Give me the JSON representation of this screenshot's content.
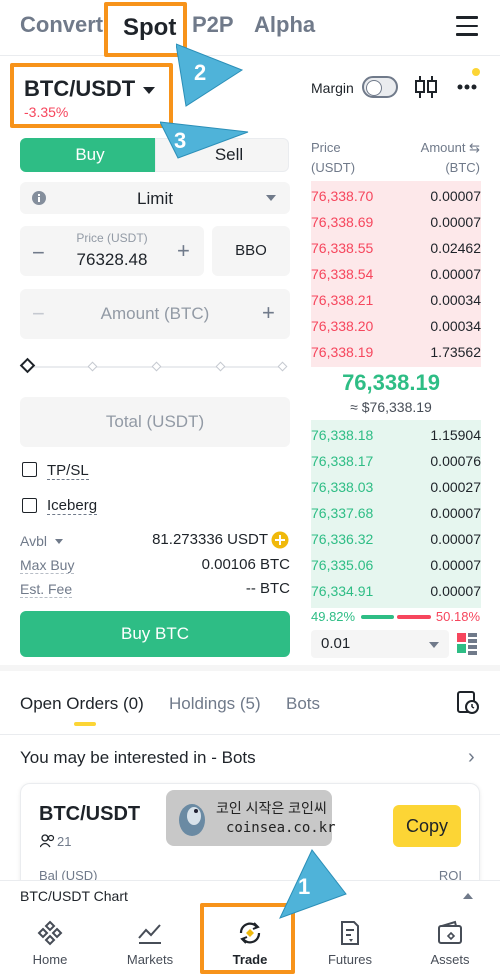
{
  "topnav": {
    "tabs": [
      "Convert",
      "Spot",
      "P2P",
      "Alpha"
    ],
    "active": "Spot"
  },
  "pair": {
    "symbol": "BTC/USDT",
    "change": "-3.35%",
    "margin_label": "Margin"
  },
  "side": {
    "buy": "Buy",
    "sell": "Sell"
  },
  "order_type": "Limit",
  "price_field": {
    "label": "Price (USDT)",
    "value": "76328.48",
    "bbo": "BBO"
  },
  "amount_field": {
    "placeholder": "Amount (BTC)"
  },
  "total_field": {
    "placeholder": "Total (USDT)"
  },
  "options": {
    "tpsl": "TP/SL",
    "iceberg": "Iceberg"
  },
  "balance": {
    "avbl_label": "Avbl",
    "avbl_value": "81.273336 USDT",
    "maxbuy_label": "Max Buy",
    "maxbuy_value": "0.00106 BTC",
    "fee_label": "Est. Fee",
    "fee_value": "-- BTC"
  },
  "buy_button": "Buy BTC",
  "orderbook": {
    "price_head": "Price",
    "price_unit": "(USDT)",
    "amount_head": "Amount",
    "amount_unit": "(BTC)",
    "asks": [
      {
        "price": "76,338.70",
        "amount": "0.00007"
      },
      {
        "price": "76,338.69",
        "amount": "0.00007"
      },
      {
        "price": "76,338.55",
        "amount": "0.02462"
      },
      {
        "price": "76,338.54",
        "amount": "0.00007"
      },
      {
        "price": "76,338.21",
        "amount": "0.00034"
      },
      {
        "price": "76,338.20",
        "amount": "0.00034"
      },
      {
        "price": "76,338.19",
        "amount": "1.73562"
      }
    ],
    "last_price": "76,338.19",
    "last_usd": "≈ $76,338.19",
    "bids": [
      {
        "price": "76,338.18",
        "amount": "1.15904"
      },
      {
        "price": "76,338.17",
        "amount": "0.00076"
      },
      {
        "price": "76,338.03",
        "amount": "0.00027"
      },
      {
        "price": "76,337.68",
        "amount": "0.00007"
      },
      {
        "price": "76,336.32",
        "amount": "0.00007"
      },
      {
        "price": "76,335.06",
        "amount": "0.00007"
      },
      {
        "price": "76,334.91",
        "amount": "0.00007"
      }
    ],
    "buy_ratio": "49.82%",
    "sell_ratio": "50.18%",
    "precision": "0.01"
  },
  "lower_tabs": [
    "Open Orders (0)",
    "Holdings (5)",
    "Bots"
  ],
  "interest": {
    "title": "You may be interested in - Bots",
    "card_pair": "BTC/USDT",
    "card_users": "21",
    "card_copy": "Copy",
    "card_left_sub": "Bal (USD)",
    "card_right_sub": "ROI"
  },
  "watermark": {
    "line1": "코인 시작은 코인씨",
    "line2": "coinsea.co.kr"
  },
  "chart_bar": "BTC/USDT Chart",
  "bottomnav": [
    "Home",
    "Markets",
    "Trade",
    "Futures",
    "Assets"
  ],
  "annotations": [
    "1",
    "2",
    "3"
  ],
  "colors": {
    "green": "#2ebd85",
    "red": "#f6465d",
    "yellow": "#fcd535",
    "highlight": "#f7931a",
    "callout": "#4fb3d9"
  }
}
